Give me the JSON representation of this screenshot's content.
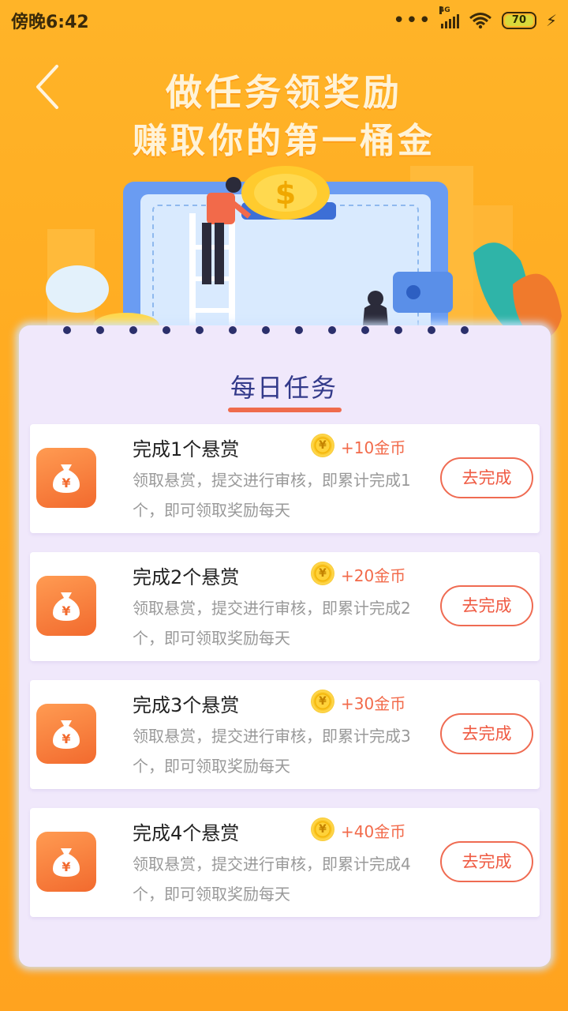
{
  "status_bar": {
    "time": "傍晚6:42",
    "dots": "•••",
    "network": "4G",
    "battery": "70"
  },
  "hero": {
    "line1": "做任务领奖励",
    "line2": "赚取你的第一桶金"
  },
  "panel": {
    "title": "每日任务"
  },
  "tasks": [
    {
      "title": "完成1个悬赏",
      "reward": "+10金币",
      "desc": "领取悬赏，提交进行审核，即累计完成1个，即可领取奖励每天",
      "button": "去完成"
    },
    {
      "title": "完成2个悬赏",
      "reward": "+20金币",
      "desc": "领取悬赏，提交进行审核，即累计完成2个，即可领取奖励每天",
      "button": "去完成"
    },
    {
      "title": "完成3个悬赏",
      "reward": "+30金币",
      "desc": "领取悬赏，提交进行审核，即累计完成3个，即可领取奖励每天",
      "button": "去完成"
    },
    {
      "title": "完成4个悬赏",
      "reward": "+40金币",
      "desc": "领取悬赏，提交进行审核，即累计完成4个，即可领取奖励每天",
      "button": "去完成"
    }
  ],
  "colors": {
    "background": "#ffac22",
    "panel": "#f0e8fb",
    "accent": "#ef6b52",
    "title": "#333a8a"
  }
}
